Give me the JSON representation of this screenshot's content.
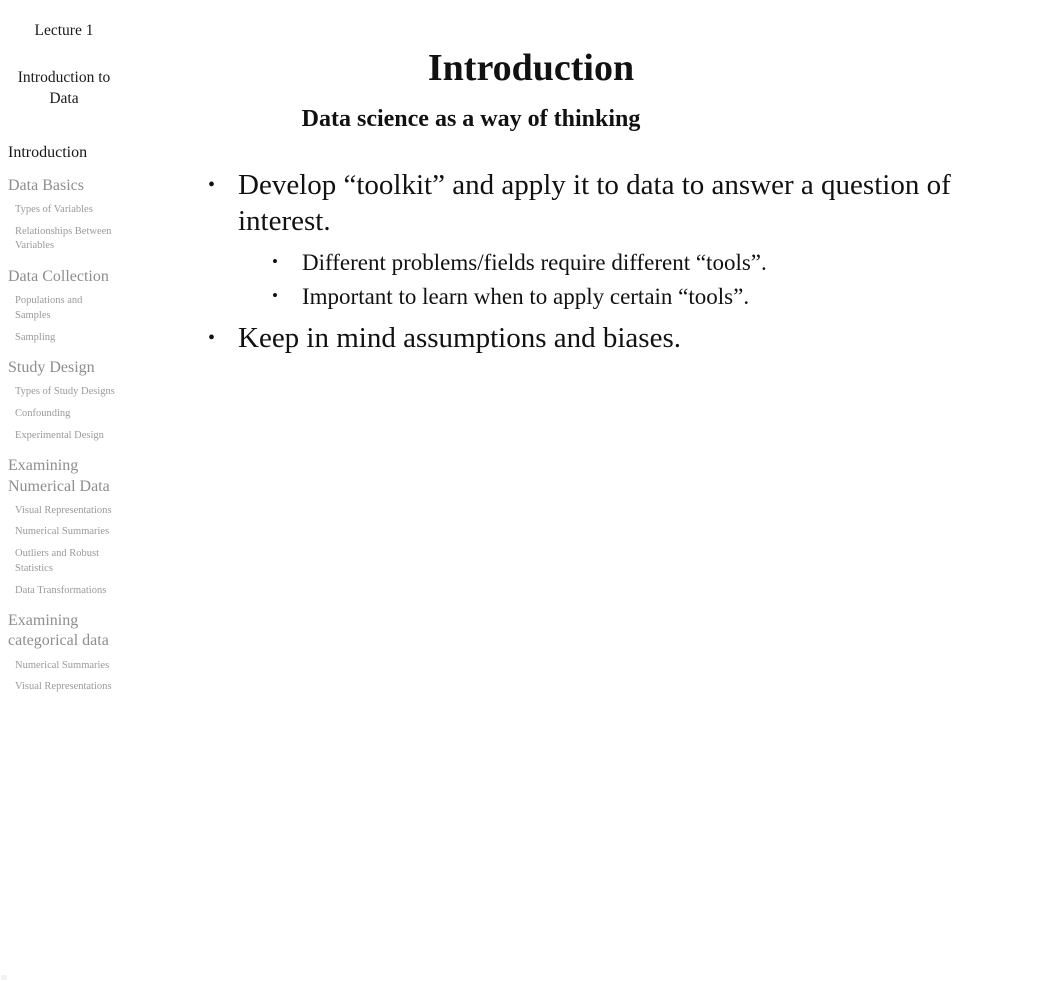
{
  "sidebar": {
    "lecture_label": "Lecture 1",
    "deck_title": "Introduction to Data",
    "groups": [
      {
        "section": "Introduction",
        "active": true,
        "items": []
      },
      {
        "section": "Data Basics",
        "active": false,
        "items": [
          "Types of Variables",
          "Relationships Between Variables"
        ]
      },
      {
        "section": "Data Collection",
        "active": false,
        "items": [
          "Populations and Samples",
          "Sampling"
        ]
      },
      {
        "section": "Study Design",
        "active": false,
        "items": [
          "Types of Study Designs",
          "Confounding",
          "Experimental Design"
        ]
      },
      {
        "section": "Examining Numerical Data",
        "active": false,
        "items": [
          "Visual Representations",
          "Numerical Summaries",
          "Outliers and Robust Statistics",
          "Data Transformations"
        ]
      },
      {
        "section": "Examining categorical data",
        "active": false,
        "items": [
          "Numerical Summaries",
          "Visual Representations"
        ]
      }
    ]
  },
  "slide": {
    "title": "Introduction",
    "subtitle": "Data science as a way of thinking",
    "bullet_glyph": "•",
    "bullets": [
      {
        "text": "Develop “toolkit” and apply it to data to answer a question of interest.",
        "children": [
          "Different problems/fields require different “tools”.",
          "Important to learn when to apply certain “tools”."
        ]
      },
      {
        "text": "Keep in mind assumptions and biases.",
        "children": []
      }
    ]
  },
  "colors": {
    "background": "#ffffff",
    "text": "#111111",
    "sidebar_muted": "#8e8e8e",
    "sidebar_subitem": "#9a9a9a",
    "sidebar_active": "#161616"
  }
}
